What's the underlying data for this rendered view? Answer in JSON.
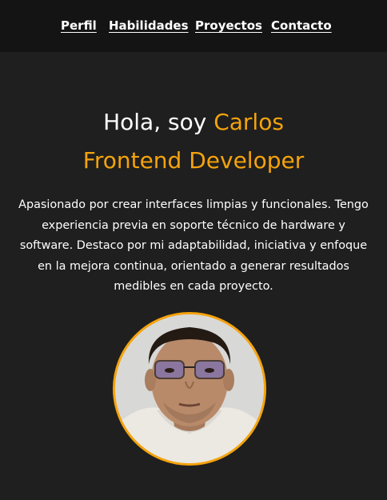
{
  "nav": {
    "items": [
      {
        "label": "Perfil"
      },
      {
        "label": "Habilidades"
      },
      {
        "label": "Proyectos"
      },
      {
        "label": "Contacto"
      }
    ]
  },
  "hero": {
    "greeting": "Hola, soy",
    "name": "Carlos",
    "role": "Frontend Developer",
    "description": "Apasionado por crear interfaces limpias y funcionales. Tengo experiencia previa en soporte técnico de hardware y software. Destaco por mi adaptabilidad, iniciativa y enfoque en la mejora continua, orientado a generar resultados medibles en cada proyecto."
  },
  "colors": {
    "accent": "#f5a30c",
    "background": "#1f1f1f",
    "navbar": "#141414",
    "text": "#ffffff"
  }
}
